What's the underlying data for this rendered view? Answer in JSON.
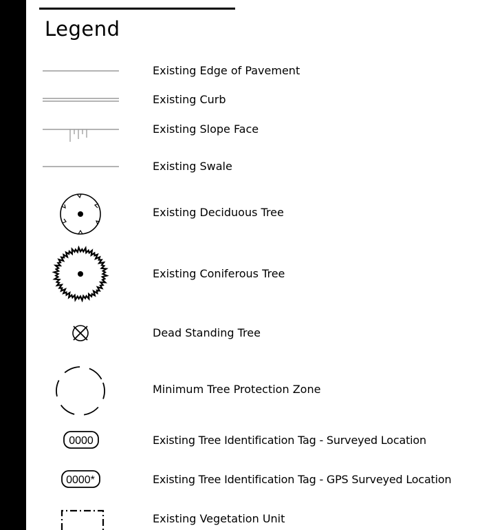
{
  "legend": {
    "title": "Legend",
    "items": [
      {
        "symbol": "edge-of-pavement-line",
        "label": "Existing Edge of Pavement"
      },
      {
        "symbol": "curb-double-line",
        "label": "Existing Curb"
      },
      {
        "symbol": "slope-face-line",
        "label": "Existing Slope Face"
      },
      {
        "symbol": "swale-line",
        "label": "Existing Swale"
      },
      {
        "symbol": "deciduous-tree-icon",
        "label": "Existing Deciduous Tree"
      },
      {
        "symbol": "coniferous-tree-icon",
        "label": "Existing Coniferous Tree"
      },
      {
        "symbol": "dead-tree-icon",
        "label": "Dead Standing Tree"
      },
      {
        "symbol": "protection-zone-icon",
        "label": "Minimum Tree Protection Zone"
      },
      {
        "symbol": "tag-surveyed",
        "tag_text": "0000",
        "label": "Existing Tree Identification Tag - Surveyed Location"
      },
      {
        "symbol": "tag-gps",
        "tag_text": "0000*",
        "label": "Existing Tree Identification Tag - GPS Surveyed Location"
      },
      {
        "symbol": "vegetation-unit-icon",
        "label": "Existing Vegetation Unit"
      }
    ]
  },
  "colors": {
    "line": "#9a9a9a",
    "ink": "#000000",
    "background": "#ffffff"
  }
}
